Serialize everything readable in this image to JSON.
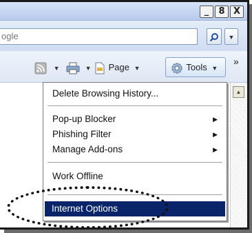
{
  "window": {
    "controls": [
      "_",
      "8",
      "X"
    ]
  },
  "search": {
    "value": "ogle"
  },
  "toolbar": {
    "page_label": "Page",
    "tools_label": "Tools",
    "overflow": "»"
  },
  "menu": {
    "items": [
      {
        "label": "Delete Browsing History...",
        "submenu": false,
        "selected": false
      },
      {
        "label": "Pop-up Blocker",
        "submenu": true,
        "selected": false
      },
      {
        "label": "Phishing Filter",
        "submenu": true,
        "selected": false
      },
      {
        "label": "Manage Add-ons",
        "submenu": true,
        "selected": false
      },
      {
        "label": "Work Offline",
        "submenu": false,
        "selected": false
      },
      {
        "label": "Internet Options",
        "submenu": false,
        "selected": true
      }
    ],
    "selected_bg": "#0a246a"
  }
}
